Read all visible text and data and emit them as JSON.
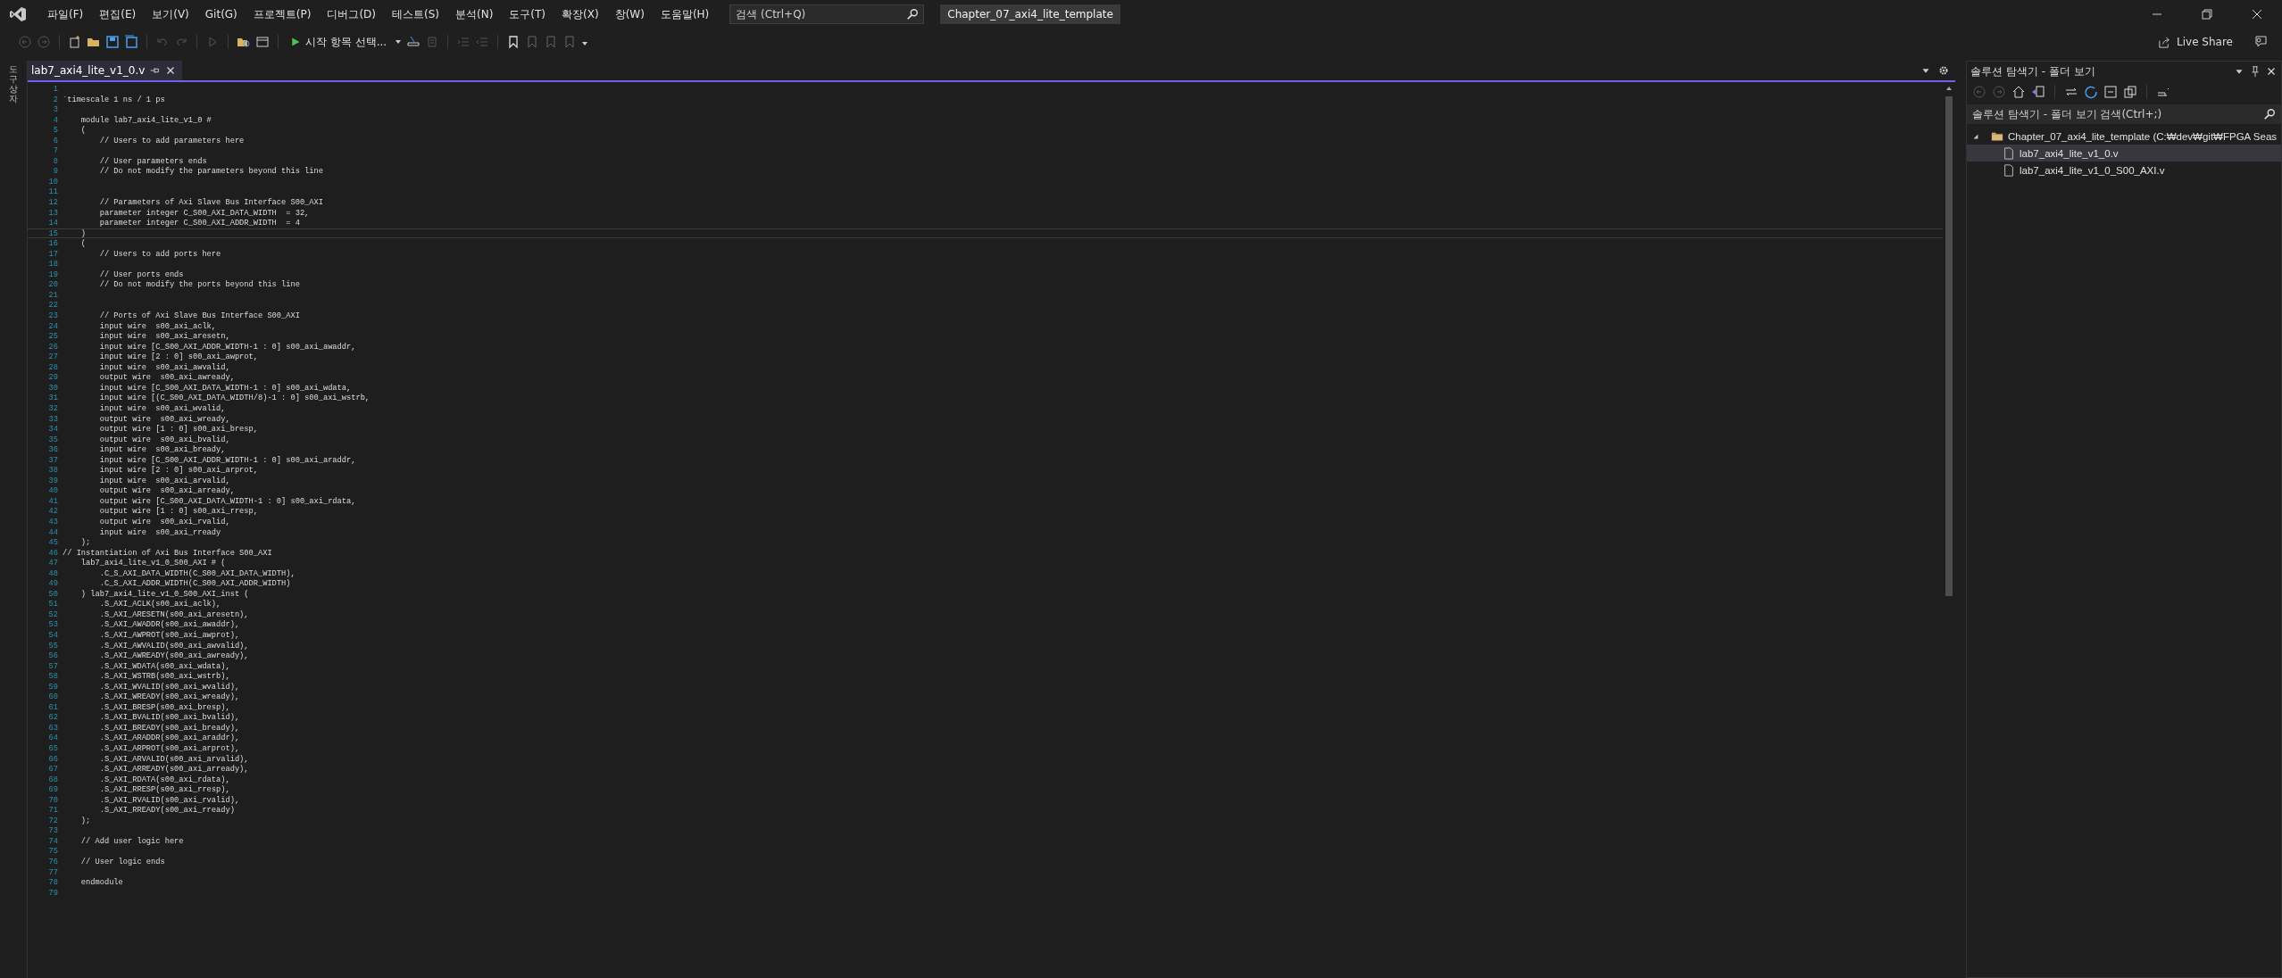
{
  "menu": [
    "파일(F)",
    "편집(E)",
    "보기(V)",
    "Git(G)",
    "프로젝트(P)",
    "디버그(D)",
    "테스트(S)",
    "분석(N)",
    "도구(T)",
    "확장(X)",
    "창(W)",
    "도움말(H)"
  ],
  "search": {
    "placeholder": "검색 (Ctrl+Q)"
  },
  "window": {
    "title": "Chapter_07_axi4_lite_template"
  },
  "toolbar": {
    "start_label": "시작 항목 선택..."
  },
  "live_share": "Live Share",
  "toolbox_label": "도구 상자",
  "tabs": [
    {
      "label": "lab7_axi4_lite_v1_0.v",
      "selected": true
    }
  ],
  "code": [
    {
      "n": "1",
      "current": false
    },
    {
      "n": "2",
      "text": "`timescale 1 ns / 1 ps",
      "current": false
    },
    {
      "n": "3",
      "current": false
    },
    {
      "n": "4",
      "text": "    module lab7_axi4_lite_v1_0 #",
      "current": false
    },
    {
      "n": "5",
      "text": "    (",
      "current": false
    },
    {
      "n": "6",
      "text": "        // Users to add parameters here",
      "current": false
    },
    {
      "n": "7",
      "current": false
    },
    {
      "n": "8",
      "text": "        // User parameters ends",
      "current": false
    },
    {
      "n": "9",
      "text": "        // Do not modify the parameters beyond this line",
      "current": false
    },
    {
      "n": "10",
      "current": false
    },
    {
      "n": "11",
      "current": false
    },
    {
      "n": "12",
      "text": "        // Parameters of Axi Slave Bus Interface S00_AXI",
      "current": false
    },
    {
      "n": "13",
      "text": "        parameter integer C_S00_AXI_DATA_WIDTH  = 32,",
      "current": false
    },
    {
      "n": "14",
      "text": "        parameter integer C_S00_AXI_ADDR_WIDTH  = 4",
      "current": false
    },
    {
      "n": "15",
      "text": "    )",
      "current": true
    },
    {
      "n": "16",
      "text": "    (",
      "current": false
    },
    {
      "n": "17",
      "text": "        // Users to add ports here",
      "current": false
    },
    {
      "n": "18",
      "current": false
    },
    {
      "n": "19",
      "text": "        // User ports ends",
      "current": false
    },
    {
      "n": "20",
      "text": "        // Do not modify the ports beyond this line",
      "current": false
    },
    {
      "n": "21",
      "current": false
    },
    {
      "n": "22",
      "current": false
    },
    {
      "n": "23",
      "text": "        // Ports of Axi Slave Bus Interface S00_AXI",
      "current": false
    },
    {
      "n": "24",
      "text": "        input wire  s00_axi_aclk,",
      "current": false
    },
    {
      "n": "25",
      "text": "        input wire  s00_axi_aresetn,",
      "current": false
    },
    {
      "n": "26",
      "text": "        input wire [C_S00_AXI_ADDR_WIDTH-1 : 0] s00_axi_awaddr,",
      "current": false
    },
    {
      "n": "27",
      "text": "        input wire [2 : 0] s00_axi_awprot,",
      "current": false
    },
    {
      "n": "28",
      "text": "        input wire  s00_axi_awvalid,",
      "current": false
    },
    {
      "n": "29",
      "text": "        output wire  s00_axi_awready,",
      "current": false
    },
    {
      "n": "30",
      "text": "        input wire [C_S00_AXI_DATA_WIDTH-1 : 0] s00_axi_wdata,",
      "current": false
    },
    {
      "n": "31",
      "text": "        input wire [(C_S00_AXI_DATA_WIDTH/8)-1 : 0] s00_axi_wstrb,",
      "current": false
    },
    {
      "n": "32",
      "text": "        input wire  s00_axi_wvalid,",
      "current": false
    },
    {
      "n": "33",
      "text": "        output wire  s00_axi_wready,",
      "current": false
    },
    {
      "n": "34",
      "text": "        output wire [1 : 0] s00_axi_bresp,",
      "current": false
    },
    {
      "n": "35",
      "text": "        output wire  s00_axi_bvalid,",
      "current": false
    },
    {
      "n": "36",
      "text": "        input wire  s00_axi_bready,",
      "current": false
    },
    {
      "n": "37",
      "text": "        input wire [C_S00_AXI_ADDR_WIDTH-1 : 0] s00_axi_araddr,",
      "current": false
    },
    {
      "n": "38",
      "text": "        input wire [2 : 0] s00_axi_arprot,",
      "current": false
    },
    {
      "n": "39",
      "text": "        input wire  s00_axi_arvalid,",
      "current": false
    },
    {
      "n": "40",
      "text": "        output wire  s00_axi_arready,",
      "current": false
    },
    {
      "n": "41",
      "text": "        output wire [C_S00_AXI_DATA_WIDTH-1 : 0] s00_axi_rdata,",
      "current": false
    },
    {
      "n": "42",
      "text": "        output wire [1 : 0] s00_axi_rresp,",
      "current": false
    },
    {
      "n": "43",
      "text": "        output wire  s00_axi_rvalid,",
      "current": false
    },
    {
      "n": "44",
      "text": "        input wire  s00_axi_rready",
      "current": false
    },
    {
      "n": "45",
      "text": "    );",
      "current": false
    },
    {
      "n": "46",
      "text": "// Instantiation of Axi Bus Interface S00_AXI",
      "current": false
    },
    {
      "n": "47",
      "text": "    lab7_axi4_lite_v1_0_S00_AXI # (",
      "current": false
    },
    {
      "n": "48",
      "text": "        .C_S_AXI_DATA_WIDTH(C_S00_AXI_DATA_WIDTH),",
      "current": false
    },
    {
      "n": "49",
      "text": "        .C_S_AXI_ADDR_WIDTH(C_S00_AXI_ADDR_WIDTH)",
      "current": false
    },
    {
      "n": "50",
      "text": "    ) lab7_axi4_lite_v1_0_S00_AXI_inst (",
      "current": false
    },
    {
      "n": "51",
      "text": "        .S_AXI_ACLK(s00_axi_aclk),",
      "current": false
    },
    {
      "n": "52",
      "text": "        .S_AXI_ARESETN(s00_axi_aresetn),",
      "current": false
    },
    {
      "n": "53",
      "text": "        .S_AXI_AWADDR(s00_axi_awaddr),",
      "current": false
    },
    {
      "n": "54",
      "text": "        .S_AXI_AWPROT(s00_axi_awprot),",
      "current": false
    },
    {
      "n": "55",
      "text": "        .S_AXI_AWVALID(s00_axi_awvalid),",
      "current": false
    },
    {
      "n": "56",
      "text": "        .S_AXI_AWREADY(s00_axi_awready),",
      "current": false
    },
    {
      "n": "57",
      "text": "        .S_AXI_WDATA(s00_axi_wdata),",
      "current": false
    },
    {
      "n": "58",
      "text": "        .S_AXI_WSTRB(s00_axi_wstrb),",
      "current": false
    },
    {
      "n": "59",
      "text": "        .S_AXI_WVALID(s00_axi_wvalid),",
      "current": false
    },
    {
      "n": "60",
      "text": "        .S_AXI_WREADY(s00_axi_wready),",
      "current": false
    },
    {
      "n": "61",
      "text": "        .S_AXI_BRESP(s00_axi_bresp),",
      "current": false
    },
    {
      "n": "62",
      "text": "        .S_AXI_BVALID(s00_axi_bvalid),",
      "current": false
    },
    {
      "n": "63",
      "text": "        .S_AXI_BREADY(s00_axi_bready),",
      "current": false
    },
    {
      "n": "64",
      "text": "        .S_AXI_ARADDR(s00_axi_araddr),",
      "current": false
    },
    {
      "n": "65",
      "text": "        .S_AXI_ARPROT(s00_axi_arprot),",
      "current": false
    },
    {
      "n": "66",
      "text": "        .S_AXI_ARVALID(s00_axi_arvalid),",
      "current": false
    },
    {
      "n": "67",
      "text": "        .S_AXI_ARREADY(s00_axi_arready),",
      "current": false
    },
    {
      "n": "68",
      "text": "        .S_AXI_RDATA(s00_axi_rdata),",
      "current": false
    },
    {
      "n": "69",
      "text": "        .S_AXI_RRESP(s00_axi_rresp),",
      "current": false
    },
    {
      "n": "70",
      "text": "        .S_AXI_RVALID(s00_axi_rvalid),",
      "current": false
    },
    {
      "n": "71",
      "text": "        .S_AXI_RREADY(s00_axi_rready)",
      "current": false
    },
    {
      "n": "72",
      "text": "    );",
      "current": false
    },
    {
      "n": "73",
      "current": false
    },
    {
      "n": "74",
      "text": "    // Add user logic here",
      "current": false
    },
    {
      "n": "75",
      "current": false
    },
    {
      "n": "76",
      "text": "    // User logic ends",
      "current": false
    },
    {
      "n": "77",
      "current": false
    },
    {
      "n": "78",
      "text": "    endmodule",
      "current": false
    },
    {
      "n": "79",
      "current": false
    }
  ],
  "explorer": {
    "title": "솔루션 탐색기 - 폴더 보기",
    "search": {
      "placeholder": "솔루션 탐색기 - 폴더 보기 검색(Ctrl+;)"
    },
    "tree": [
      {
        "label": "Chapter_07_axi4_lite_template (C:₩dev₩git₩FPGA Seas",
        "kind": "folder",
        "expanded": true,
        "selected": false,
        "children": [
          {
            "label": "lab7_axi4_lite_v1_0.v",
            "kind": "file",
            "selected": true
          },
          {
            "label": "lab7_axi4_lite_v1_0_S00_AXI.v",
            "kind": "file",
            "selected": false
          }
        ]
      }
    ]
  }
}
